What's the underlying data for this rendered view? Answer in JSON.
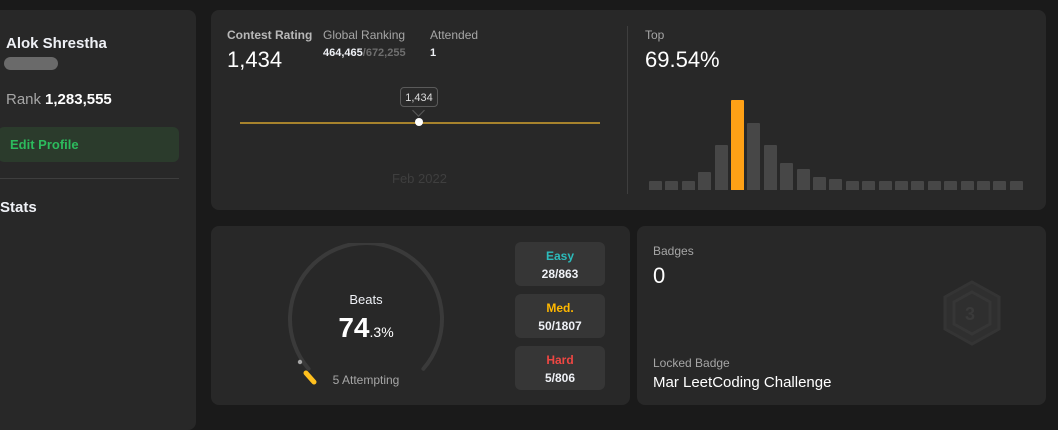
{
  "profile": {
    "name": "Alok Shrestha",
    "rank_label": "Rank",
    "rank_value": "1,283,555",
    "edit_profile_label": "Edit Profile",
    "stats_title": "Stats",
    "edge_chars": [
      "0"
    ]
  },
  "contest": {
    "rating_label": "Contest Rating",
    "rating_value": "1,434",
    "global_ranking_label": "Global Ranking",
    "global_ranking_value": "464,465",
    "global_ranking_total": "/672,255",
    "attended_label": "Attended",
    "attended_value": "1",
    "tooltip_value": "1,434",
    "x_tick": "Feb 2022",
    "top_label": "Top",
    "top_value": "69.54%"
  },
  "chart_data": {
    "type": "bar",
    "title": "",
    "highlight_index": 5,
    "values": [
      1,
      1,
      1,
      2,
      5,
      10,
      7.5,
      5,
      3,
      2.3,
      1.5,
      1.2,
      1,
      1,
      1,
      1,
      1,
      1,
      1,
      1,
      1,
      1,
      1
    ],
    "ylim": [
      0,
      10
    ],
    "colors": {
      "bar": "#474747",
      "highlight": "#ffa116"
    }
  },
  "solved": {
    "beats_label": "Beats",
    "beats_int": "74",
    "beats_dec": ".3%",
    "attempting_text": "5 Attempting",
    "difficulties": [
      {
        "name": "Easy",
        "count": "28/863",
        "color": "#2cbbbb"
      },
      {
        "name": "Med.",
        "count": "50/1807",
        "color": "#ffb800"
      },
      {
        "name": "Hard",
        "count": "5/806",
        "color": "#ef4743"
      }
    ]
  },
  "badges": {
    "label": "Badges",
    "count": "0",
    "locked_label": "Locked Badge",
    "locked_name": "Mar LeetCoding Challenge"
  }
}
